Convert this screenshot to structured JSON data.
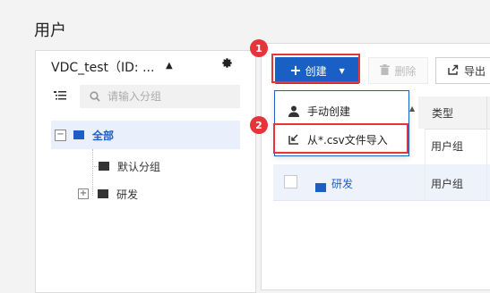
{
  "page": {
    "title": "用户"
  },
  "tree_panel": {
    "vdc_title": "VDC_test（ID: ...",
    "search_placeholder": "请输入分组",
    "nodes": [
      {
        "label": "全部",
        "selected": true,
        "expanded": true
      },
      {
        "label": "默认分组"
      },
      {
        "label": "研发",
        "collapsed": true
      }
    ]
  },
  "toolbar": {
    "create_label": "创建",
    "delete_label": "删除",
    "export_label": "导出"
  },
  "dropdown": {
    "items": [
      {
        "label": "手动创建",
        "icon": "user-icon"
      },
      {
        "label": "从*.csv文件导入",
        "icon": "import-icon"
      }
    ]
  },
  "table": {
    "header_type": "类型",
    "rows": [
      {
        "name": "",
        "type": "用户组"
      },
      {
        "name": "研发",
        "type": "用户组"
      }
    ]
  },
  "callouts": [
    "1",
    "2"
  ],
  "colors": {
    "accent": "#1a5fc4",
    "highlight": "#e5343a"
  }
}
